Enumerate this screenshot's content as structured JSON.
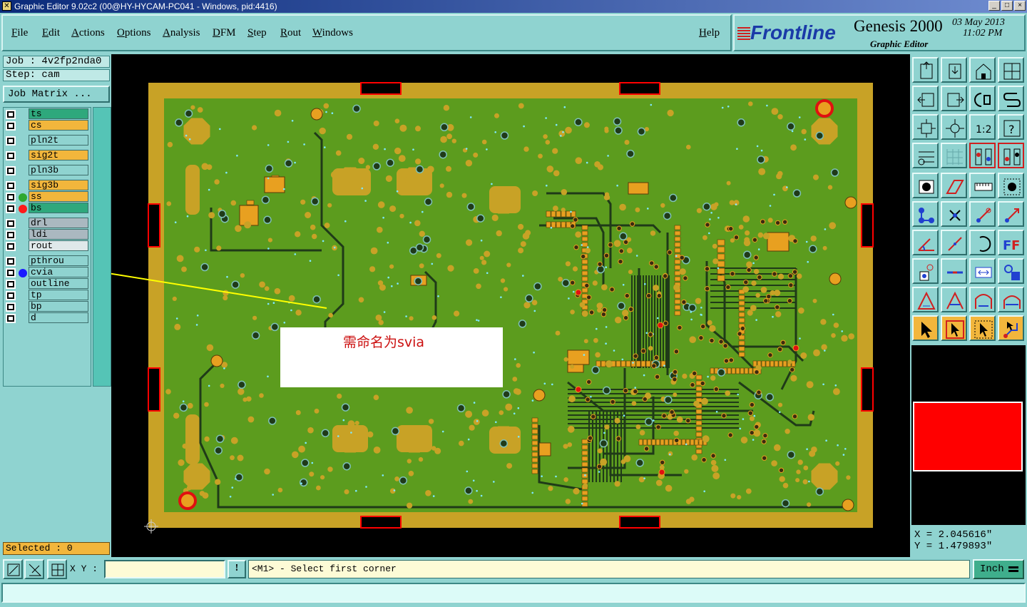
{
  "window": {
    "title": "Graphic Editor 9.02c2 (00@HY-HYCAM-PC041 - Windows, pid:4416)",
    "controls": [
      "_",
      "□",
      "×"
    ]
  },
  "menu": {
    "items": [
      "File",
      "Edit",
      "Actions",
      "Options",
      "Analysis",
      "DFM",
      "Step",
      "Rout",
      "Windows"
    ],
    "help": "Help"
  },
  "logo": {
    "brand": "Frontline",
    "product": "Genesis 2000",
    "subtitle": "Graphic Editor",
    "date": "03 May 2013",
    "time": "11:02 PM"
  },
  "job": {
    "job_text": "Job : 4v2fp2nda0",
    "step_text": "Step: cam",
    "matrix_button": "Job Matrix ..."
  },
  "layers": [
    {
      "name": "ts",
      "color": "#2ea87c",
      "work": null
    },
    {
      "name": "cs",
      "color": "#f2b63c",
      "work": null
    },
    {
      "name": "pln2t",
      "color": "#8fd3d0",
      "work": null
    },
    {
      "name": "sig2t",
      "color": "#f2b63c",
      "work": null
    },
    {
      "name": "pln3b",
      "color": "#8fd3d0",
      "work": null
    },
    {
      "name": "sig3b",
      "color": "#f2b63c",
      "work": null
    },
    {
      "name": "ss",
      "color": "#f2b63c",
      "work": "#2ea830"
    },
    {
      "name": "bs",
      "color": "#2ea87c",
      "work": "#ff1a1a"
    },
    {
      "name": "drl",
      "color": "#aab8c0",
      "work": null
    },
    {
      "name": "ldi",
      "color": "#aab8c0",
      "work": null
    },
    {
      "name": "rout",
      "color": "#dfe8ea",
      "work": null
    },
    {
      "name": "pthrou",
      "color": "#8fd3d0",
      "work": null
    },
    {
      "name": "cvia",
      "color": "#8fd3d0",
      "work": "#1a1aff"
    },
    {
      "name": "outline",
      "color": "#8fd3d0",
      "work": null
    },
    {
      "name": "tp",
      "color": "#8fd3d0",
      "work": null
    },
    {
      "name": "bp",
      "color": "#8fd3d0",
      "work": null
    },
    {
      "name": "d",
      "color": "#8fd3d0",
      "work": null
    }
  ],
  "selected_text": "Selected : 0",
  "annotation": {
    "text": "需命名为svia"
  },
  "coords": {
    "x_text": "X = 2.045616\"",
    "y_text": "Y = 1.479893\""
  },
  "bottom": {
    "xy_label": "X Y :",
    "xy_value": "",
    "bang": "!",
    "prompt": "<M1> - Select first corner",
    "units": "Inch"
  },
  "colors": {
    "board_green": "#5c9c1e",
    "copper": "#c8a226",
    "background": "#8fd3d0",
    "highlight": "#f2b63c"
  },
  "tool_icons": [
    "zoom-home-icon",
    "zoom-fit-icon",
    "home-icon",
    "split-view-icon",
    "pan-left-icon",
    "pan-right-icon",
    "rotate-icon",
    "snake-icon",
    "fit-window-icon",
    "center-icon",
    "scale-1to2-icon",
    "help-icon",
    "ruler-settings-icon",
    "grid-icon",
    "layer-compare-icon",
    "layer-compare-alt-icon",
    "feature-info-icon",
    "polygon-icon",
    "measure-icon",
    "record-icon",
    "net-connect-icon",
    "cross-select-icon",
    "add-line-icon",
    "add-arrow-icon",
    "angle-icon",
    "line-slope-icon",
    "arc-icon",
    "ff-text-icon",
    "pad-move-icon",
    "minus-icon",
    "resize-icon",
    "group-icon",
    "triangle-outline-icon",
    "triangle-filled-icon",
    "arch-icon",
    "arch-alt-icon",
    "pointer-icon",
    "pointer-select-icon",
    "pointer-area-icon",
    "route-icon"
  ]
}
